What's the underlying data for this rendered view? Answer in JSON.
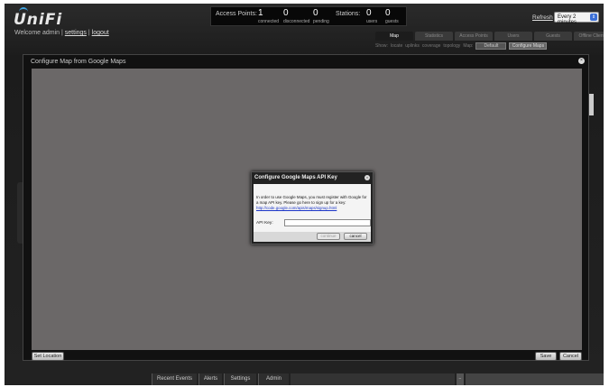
{
  "header": {
    "logo": "UniFi",
    "welcome_prefix": "Welcome admin |",
    "settings_link": "settings",
    "logout_link": "logout",
    "separator": "|"
  },
  "stats": {
    "access_points_label": "Access Points:",
    "connected_value": "1",
    "connected_label": "connected",
    "disconnected_value": "0",
    "disconnected_label": "disconnected",
    "pending_value": "0",
    "pending_label": "pending",
    "stations_label": "Stations:",
    "users_value": "0",
    "users_label": "users",
    "guests_value": "0",
    "guests_label": "guests"
  },
  "refresh": {
    "label": "Refresh",
    "selected": "Every 2 minutes"
  },
  "tabs": [
    "Map",
    "Statistics",
    "Access Points",
    "Users",
    "Guests",
    "Offline Clients"
  ],
  "subbar": {
    "show_label": "Show:",
    "items": [
      "locate",
      "uplinks",
      "coverage",
      "topology"
    ],
    "map_label": "Map:",
    "map_value": "Default",
    "configure_button": "Configure Maps"
  },
  "panel": {
    "title": "Configure Map from Google Maps",
    "set_location_button": "Set Location",
    "save_button": "Save",
    "cancel_button": "Cancel"
  },
  "dialog": {
    "title": "Configure Google Maps API Key",
    "message": "In order to use Google Maps, you must register with Google for a map API key. Please go here to sign up for a key:",
    "link": "http://code.google.com/apis/maps/signup.html",
    "api_key_label": "API Key:",
    "api_key_value": "",
    "continue_button": "continue",
    "cancel_button": "cancel"
  },
  "bottom_tabs": [
    "Recent Events",
    "Alerts",
    "Settings",
    "Admin"
  ],
  "colors": {
    "map_bg": "#6b6868",
    "accent_blue": "#3fa3e0",
    "link_blue": "#1b35c8"
  }
}
